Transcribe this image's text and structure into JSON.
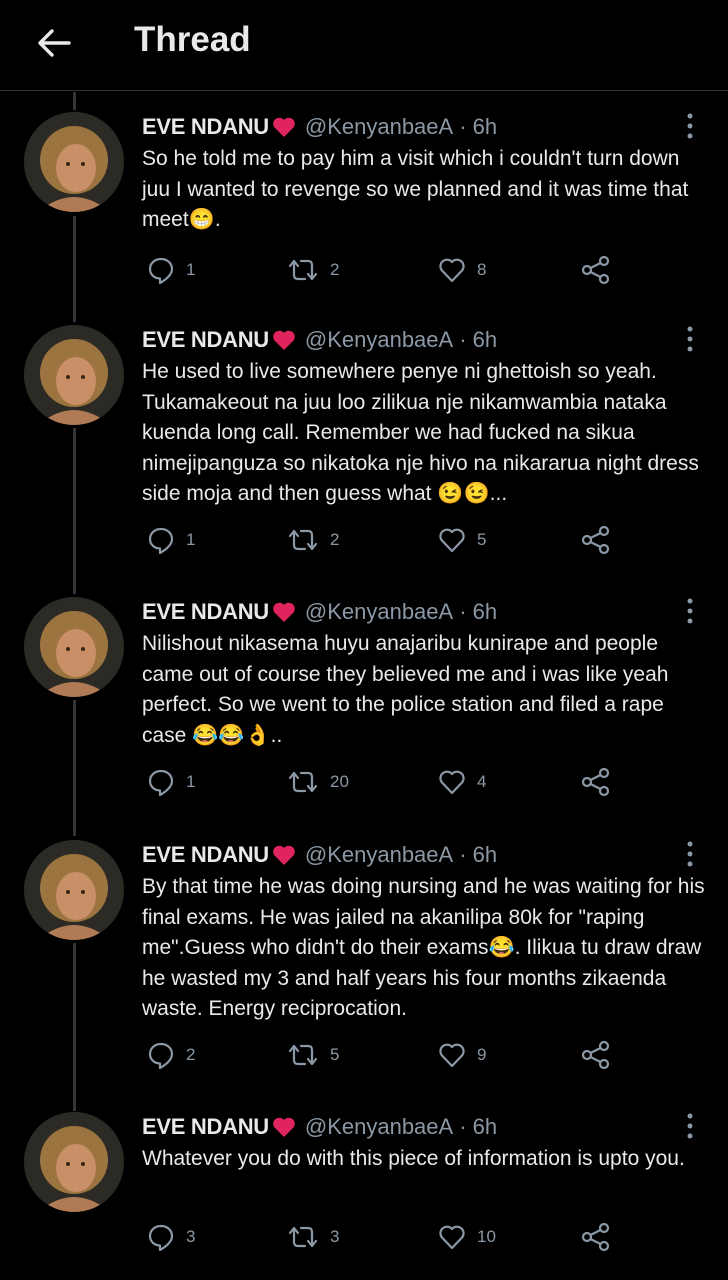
{
  "header": {
    "title": "Thread",
    "back_icon": "arrow-left-icon"
  },
  "tweets": [
    {
      "name": "EVE NDANU",
      "handle": "@KenyanbaeA",
      "time": "· 6h",
      "text": "So he told me to pay him a visit which i couldn't turn down juu I wanted to revenge so we planned and it was time that meet😁.",
      "replies": "1",
      "retweets": "2",
      "likes": "8"
    },
    {
      "name": "EVE NDANU",
      "handle": "@KenyanbaeA",
      "time": "· 6h",
      "text": "He used to live somewhere penye ni ghettoish so yeah. Tukamakeout na juu loo zilikua nje nikamwambia nataka kuenda long call. Remember we had fucked na sikua nimejipanguza so nikatoka nje hivo na nikararua night dress side moja and then guess what 😉😉...",
      "replies": "1",
      "retweets": "2",
      "likes": "5"
    },
    {
      "name": "EVE NDANU",
      "handle": "@KenyanbaeA",
      "time": "· 6h",
      "text": "Nilishout nikasema huyu anajaribu kunirape and people came out of course they believed me and i was like yeah perfect. So we went to the police station and filed a rape case 😂😂👌..",
      "replies": "1",
      "retweets": "20",
      "likes": "4"
    },
    {
      "name": "EVE NDANU",
      "handle": "@KenyanbaeA",
      "time": "· 6h",
      "text": "By that time he was doing nursing and he was waiting for his final exams. He was jailed na akanilipa 80k for \"raping me\".Guess who didn't do their exams😂. Ilikua tu draw draw he wasted my 3 and half years his four months zikaenda waste. Energy reciprocation.",
      "replies": "2",
      "retweets": "5",
      "likes": "9"
    },
    {
      "name": "EVE NDANU",
      "handle": "@KenyanbaeA",
      "time": "· 6h",
      "text": "Whatever you do with this piece of information is upto you.",
      "replies": "3",
      "retweets": "3",
      "likes": "10"
    }
  ],
  "colors": {
    "background": "#000000",
    "text": "#e7e9ea",
    "muted": "#8b98a5",
    "heart": "#e0245e"
  }
}
